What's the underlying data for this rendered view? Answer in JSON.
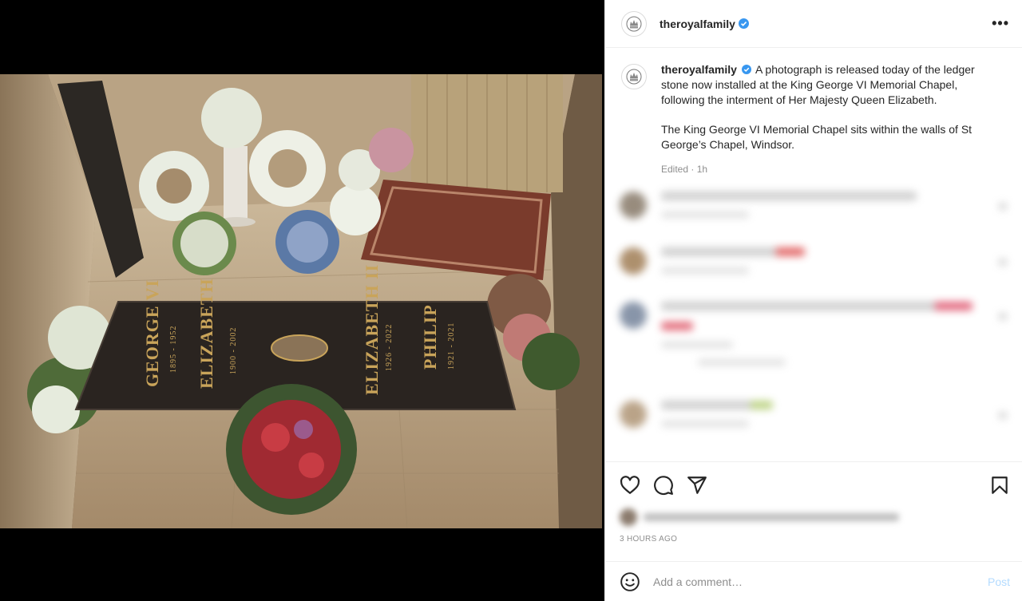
{
  "post": {
    "username": "theroyalfamily",
    "verified": true,
    "more_icon": "more-horizontal-icon",
    "caption_paragraph_1": "A photograph is released today of the ledger stone now installed at the King George VI Memorial Chapel, following the interment of Her Majesty Queen Elizabeth.",
    "caption_paragraph_2": "The King George VI Memorial Chapel sits within the walls of St George’s Chapel, Windsor.",
    "edited_label": "Edited · 1h",
    "timestamp": "3 HOURS AGO"
  },
  "ledger_stone": {
    "name_1": "GEORGE VI",
    "dates_1": "1895 - 1952",
    "name_2": "ELIZABETH",
    "dates_2": "1900 - 2002",
    "name_3": "ELIZABETH II",
    "dates_3": "1926 - 2022",
    "name_4": "PHILIP",
    "dates_4": "1921 - 2021"
  },
  "actions": {
    "like_icon": "heart-icon",
    "comment_icon": "comment-bubble-icon",
    "share_icon": "paper-plane-icon",
    "save_icon": "bookmark-icon"
  },
  "comment_box": {
    "emoji_icon": "emoji-smiley-icon",
    "placeholder": "Add a comment…",
    "post_label": "Post"
  },
  "colors": {
    "link_disabled": "#b3dbff",
    "verified_blue": "#3897f0",
    "muted_text": "#8e8e8e"
  }
}
